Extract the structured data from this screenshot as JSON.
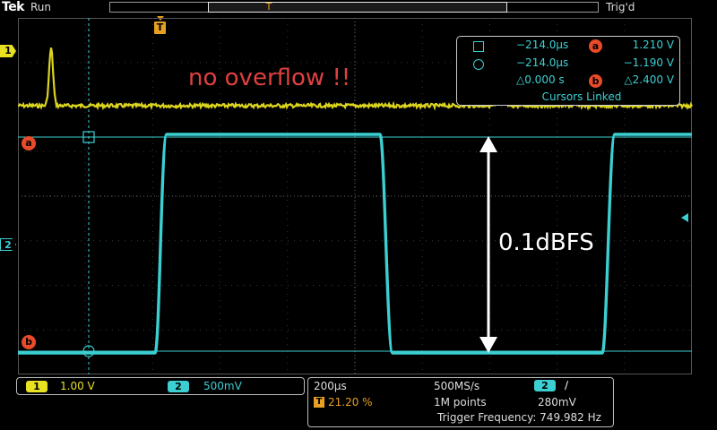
{
  "header": {
    "brand": "Tek",
    "run_state": "Run",
    "trigger_state": "Trig'd",
    "trigger_marker": "T",
    "record_marker": "T"
  },
  "channels": {
    "ch1": {
      "number": "1",
      "scale": "1.00 V",
      "color": "#e8e020"
    },
    "ch2": {
      "number": "2",
      "scale": "500mV",
      "color": "#3ccfd2"
    }
  },
  "cursors": {
    "a_label": "a",
    "b_label": "b",
    "rows": [
      {
        "icon": "square",
        "time": "−214.0µs",
        "label": "a",
        "value": "1.210 V"
      },
      {
        "icon": "circle",
        "time": "−214.0µs",
        "label": "",
        "value": "−1.190 V"
      },
      {
        "icon": "",
        "time": "△0.000 s",
        "label": "b",
        "value": "△2.400 V"
      }
    ],
    "linked_text": "Cursors Linked",
    "color": "#e84a2a"
  },
  "annotations": {
    "overflow_note": "no overflow !!",
    "level_note": "0.1dBFS",
    "overflow_color": "#e04040"
  },
  "acquisition": {
    "timebase": "200µs",
    "sample_rate": "500MS/s",
    "trigger_position_marker": "T",
    "trigger_position": "21.20 %",
    "record_length": "1M points",
    "trigger_channel": "2",
    "trigger_slope": "∕",
    "trigger_level": "280mV",
    "trigger_frequency": "Trigger Frequency: 749.982 Hz"
  }
}
